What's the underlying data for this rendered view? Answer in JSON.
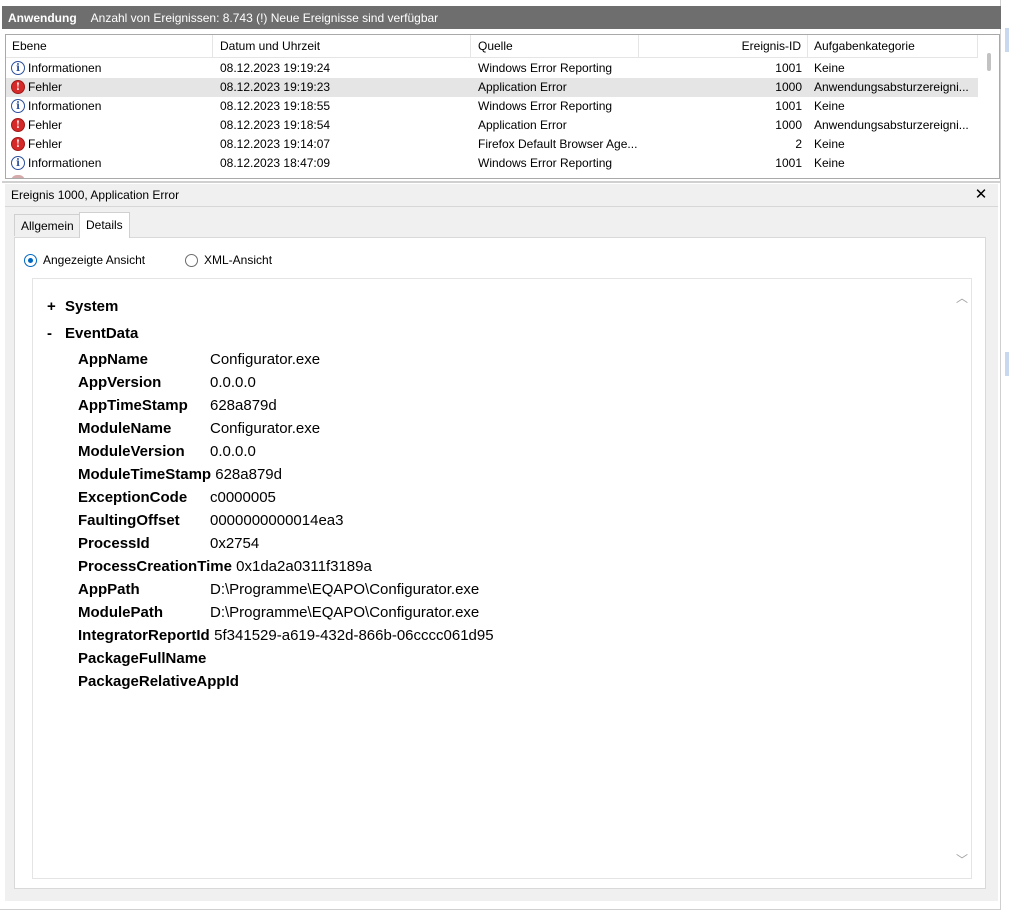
{
  "titlebar": {
    "app": "Anwendung",
    "count_text": "Anzahl von Ereignissen: 8.743 (!) Neue Ereignisse sind verfügbar"
  },
  "events": {
    "columns": [
      "Ebene",
      "Datum und Uhrzeit",
      "Quelle",
      "Ereignis-ID",
      "Aufgabenkategorie"
    ],
    "rows": [
      {
        "level": "Informationen",
        "icon": "info-icon",
        "datetime": "08.12.2023 19:19:24",
        "source": "Windows Error Reporting",
        "id": "1001",
        "category": "Keine"
      },
      {
        "level": "Fehler",
        "icon": "error-icon",
        "datetime": "08.12.2023 19:19:23",
        "source": "Application Error",
        "id": "1000",
        "category": "Anwendungsabsturzereigni..."
      },
      {
        "level": "Informationen",
        "icon": "info-icon",
        "datetime": "08.12.2023 19:18:55",
        "source": "Windows Error Reporting",
        "id": "1001",
        "category": "Keine"
      },
      {
        "level": "Fehler",
        "icon": "error-icon",
        "datetime": "08.12.2023 19:18:54",
        "source": "Application Error",
        "id": "1000",
        "category": "Anwendungsabsturzereigni..."
      },
      {
        "level": "Fehler",
        "icon": "error-icon",
        "datetime": "08.12.2023 19:14:07",
        "source": "Firefox Default Browser Age...",
        "id": "2",
        "category": "Keine"
      },
      {
        "level": "Informationen",
        "icon": "info-icon",
        "datetime": "08.12.2023 18:47:09",
        "source": "Windows Error Reporting",
        "id": "1001",
        "category": "Keine"
      }
    ]
  },
  "detail": {
    "title": "Ereignis 1000, Application Error",
    "tabs": [
      "Allgemein",
      "Details"
    ],
    "view_options": [
      "Angezeigte Ansicht",
      "XML-Ansicht"
    ],
    "nodes": {
      "system": {
        "sign": "+",
        "label": "System"
      },
      "eventdata": {
        "sign": "-",
        "label": "EventData"
      }
    },
    "fields": [
      {
        "name": "AppName",
        "value": "Configurator.exe"
      },
      {
        "name": "AppVersion",
        "value": "0.0.0.0"
      },
      {
        "name": "AppTimeStamp",
        "value": "628a879d"
      },
      {
        "name": "ModuleName",
        "value": "Configurator.exe"
      },
      {
        "name": "ModuleVersion",
        "value": "0.0.0.0"
      },
      {
        "name": "ModuleTimeStamp",
        "value": "628a879d"
      },
      {
        "name": "ExceptionCode",
        "value": "c0000005"
      },
      {
        "name": "FaultingOffset",
        "value": "0000000000014ea3"
      },
      {
        "name": "ProcessId",
        "value": "0x2754"
      },
      {
        "name": "ProcessCreationTime",
        "value": "0x1da2a0311f3189a"
      },
      {
        "name": "AppPath",
        "value": "D:\\Programme\\EQAPO\\Configurator.exe"
      },
      {
        "name": "ModulePath",
        "value": "D:\\Programme\\EQAPO\\Configurator.exe"
      },
      {
        "name": "IntegratorReportId",
        "value": "5f341529-a619-432d-866b-06cccc061d95"
      },
      {
        "name": "PackageFullName",
        "value": ""
      },
      {
        "name": "PackageRelativeAppId",
        "value": ""
      }
    ]
  },
  "colors": {
    "titlebar_bg": "#6e6e6e",
    "selected_row": "#e5e5e5",
    "radio_accent": "#0067c0",
    "error_red": "#d62a2a",
    "info_blue": "#2b4f9c"
  }
}
